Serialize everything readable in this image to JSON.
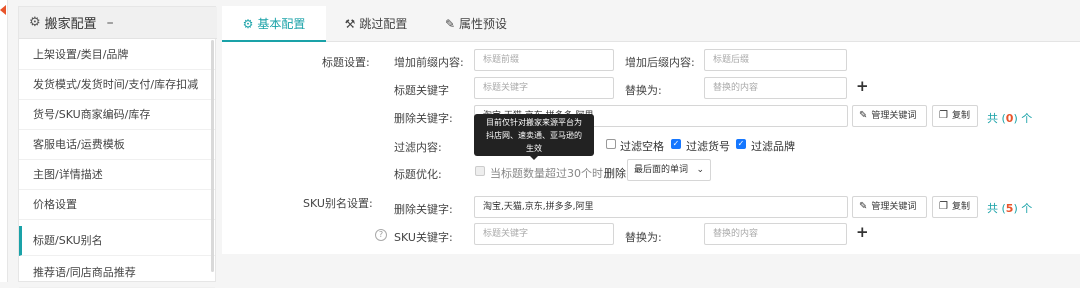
{
  "sidebar": {
    "title": "搬家配置",
    "collapse": "–",
    "items": [
      {
        "label": "上架设置/类目/品牌"
      },
      {
        "label": "发货模式/发货时间/支付/库存扣减"
      },
      {
        "label": "货号/SKU商家编码/库存"
      },
      {
        "label": "客服电话/运费模板"
      },
      {
        "label": "主图/详情描述"
      },
      {
        "label": "价格设置"
      },
      {
        "label": "标题/SKU别名"
      },
      {
        "label": "推荐语/同店商品推荐"
      }
    ],
    "active_index": 6
  },
  "tabs": [
    {
      "label": "基本配置",
      "icon": "gear-icon",
      "glyph": "⚙"
    },
    {
      "label": "跳过配置",
      "icon": "wrench-icon",
      "glyph": "🔧"
    },
    {
      "label": "属性预设",
      "icon": "edit-icon",
      "glyph": "✎"
    }
  ],
  "title_settings": {
    "section_label": "标题设置:",
    "prefix_label": "增加前缀内容:",
    "prefix_placeholder": "标题前缀",
    "suffix_label": "增加后缀内容:",
    "suffix_placeholder": "标题后缀",
    "keyword_label": "标题关键字",
    "keyword_placeholder": "标题关键字",
    "replace_label": "替换为:",
    "replace_placeholder": "替换的内容",
    "add": "+",
    "delete_label": "删除关键字:",
    "delete_value": "淘宝,天猫,京东,拼多多,阿里",
    "manage_button": "管理关键词",
    "copy_button": "复制",
    "count_prefix": "共 (",
    "count": "0",
    "count_suffix": ") 个",
    "filter_label": "过滤内容:",
    "filters": [
      {
        "label": "过滤空格",
        "checked": false
      },
      {
        "label": "过滤货号",
        "checked": true
      },
      {
        "label": "过滤品牌",
        "checked": true
      }
    ],
    "optimize_label": "标题优化:",
    "optimize_checkbox": "当标题数量超过30个时,",
    "optimize_delete": "删除",
    "optimize_select": "最后面的单词",
    "tooltip_lines": [
      "目前仅针对搬家来源平台为",
      "抖店网、速卖通、亚马逊的",
      "生效"
    ]
  },
  "sku_settings": {
    "section_label": "SKU别名设置:",
    "delete_label": "删除关键字:",
    "delete_value": "淘宝,天猫,京东,拼多多,阿里",
    "manage_button": "管理关键词",
    "copy_button": "复制",
    "count_prefix": "共 (",
    "count": "5",
    "count_suffix": ") 个",
    "keyword_label": "SKU关键字:",
    "keyword_placeholder": "标题关键字",
    "replace_label": "替换为:",
    "replace_placeholder": "替换的内容",
    "add": "+",
    "help": "?"
  }
}
